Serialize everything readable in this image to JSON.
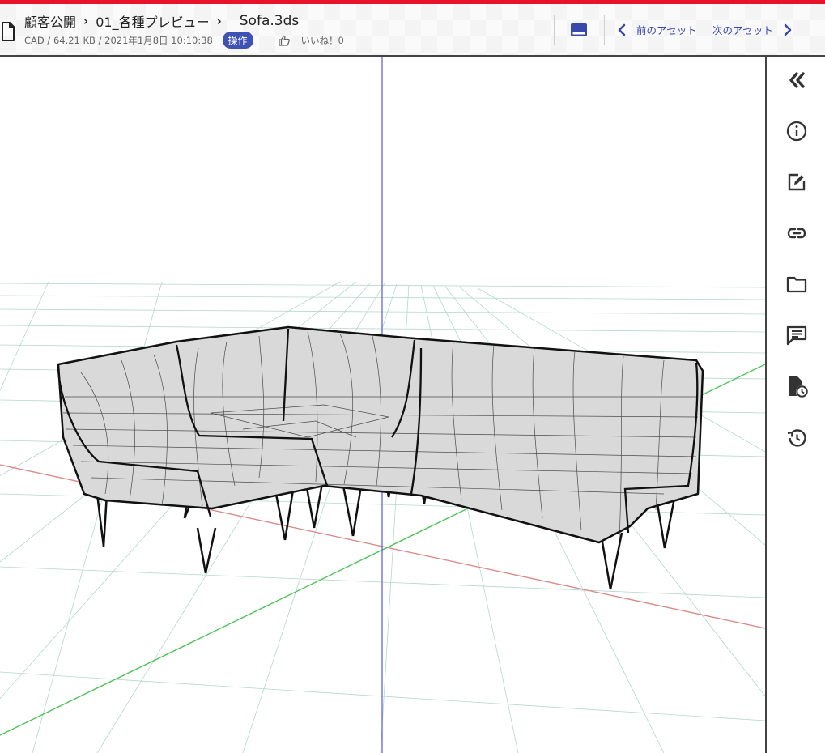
{
  "header": {
    "breadcrumb": [
      "顧客公開",
      "01_各種プレビュー"
    ],
    "breadcrumb_separator": "›",
    "file_name": "Sofa.3ds",
    "meta": "CAD / 64.21 KB / 2021年1月8日 10:10:38",
    "operation_label": "操作",
    "likes": "いいね！0",
    "prev_asset": "前のアセット",
    "next_asset": "次のアセット"
  },
  "icons": {
    "file": "file-icon",
    "like": "thumbs-up-icon",
    "panel_toggle": "panel-toggle-icon"
  },
  "sidebar": {
    "items": [
      "collapse-icon",
      "info-icon",
      "edit-icon",
      "link-icon",
      "folder-icon",
      "comment-icon",
      "file-clock-icon",
      "history-icon"
    ]
  },
  "colors": {
    "accent": "#e8132b",
    "primary": "#3f51b5",
    "axis_x": "#d98b8b",
    "axis_z": "#4fc25a",
    "axis_y": "#5b5bd6",
    "grid": "#9fc8c0"
  }
}
